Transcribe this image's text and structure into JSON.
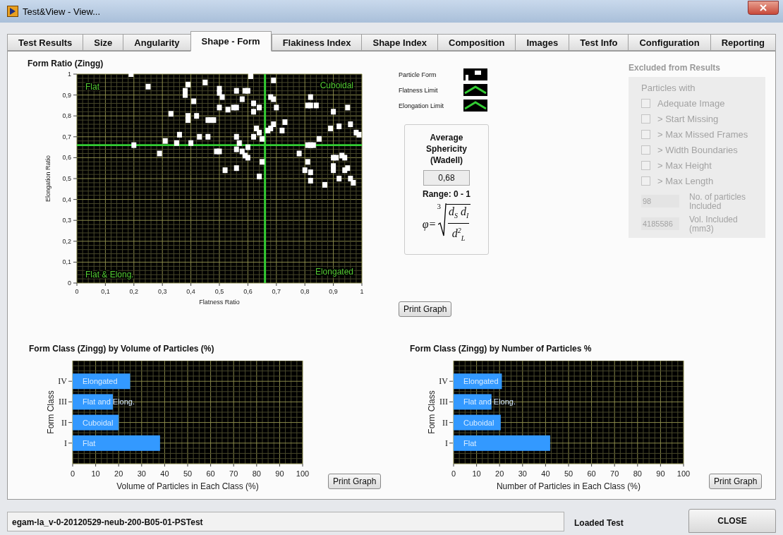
{
  "window": {
    "title": "Test&View - View..."
  },
  "tabs": [
    {
      "label": "Test Results",
      "selected": false
    },
    {
      "label": "Size",
      "selected": false
    },
    {
      "label": "Angularity",
      "selected": false
    },
    {
      "label": "Shape - Form",
      "selected": true
    },
    {
      "label": "Flakiness Index",
      "selected": false
    },
    {
      "label": "Shape Index",
      "selected": false
    },
    {
      "label": "Composition",
      "selected": false
    },
    {
      "label": "Images",
      "selected": false
    },
    {
      "label": "Test Info",
      "selected": false
    },
    {
      "label": "Configuration",
      "selected": false
    },
    {
      "label": "Reporting",
      "selected": false
    }
  ],
  "form_ratio": {
    "title": "Form Ratio (Zingg)",
    "print_button": "Print Graph",
    "chart_data": {
      "type": "scatter",
      "xlabel": "Flatness Ratio",
      "ylabel": "Elongation Ratio",
      "xlim": [
        0,
        1
      ],
      "ylim": [
        0,
        1
      ],
      "grid": true,
      "xticks": [
        {
          "value": 0,
          "label": "0"
        },
        {
          "value": 0.1,
          "label": "0,1"
        },
        {
          "value": 0.2,
          "label": "0,2"
        },
        {
          "value": 0.3,
          "label": "0,3"
        },
        {
          "value": 0.4,
          "label": "0,4"
        },
        {
          "value": 0.5,
          "label": "0,5"
        },
        {
          "value": 0.6,
          "label": "0,6"
        },
        {
          "value": 0.7,
          "label": "0,7"
        },
        {
          "value": 0.8,
          "label": "0,8"
        },
        {
          "value": 0.9,
          "label": "0,9"
        },
        {
          "value": 1,
          "label": "1"
        }
      ],
      "yticks": [
        {
          "value": 0,
          "label": "0"
        },
        {
          "value": 0.1,
          "label": "0,1"
        },
        {
          "value": 0.2,
          "label": "0,2"
        },
        {
          "value": 0.3,
          "label": "0,3"
        },
        {
          "value": 0.4,
          "label": "0,4"
        },
        {
          "value": 0.5,
          "label": "0,5"
        },
        {
          "value": 0.6,
          "label": "0,6"
        },
        {
          "value": 0.7,
          "label": "0,7"
        },
        {
          "value": 0.8,
          "label": "0,8"
        },
        {
          "value": 0.9,
          "label": "0,9"
        },
        {
          "value": 1,
          "label": "1"
        }
      ],
      "series": [
        {
          "name": "Particle Form",
          "color": "#ffffff",
          "x": [
            0.19,
            0.25,
            0.2,
            0.29,
            0.31,
            0.33,
            0.35,
            0.36,
            0.38,
            0.38,
            0.39,
            0.39,
            0.39,
            0.4,
            0.41,
            0.42,
            0.43,
            0.45,
            0.46,
            0.46,
            0.47,
            0.48,
            0.49,
            0.5,
            0.5,
            0.5,
            0.51,
            0.5,
            0.52,
            0.53,
            0.55,
            0.56,
            0.56,
            0.56,
            0.56,
            0.56,
            0.57,
            0.58,
            0.58,
            0.59,
            0.6,
            0.59,
            0.6,
            0.6,
            0.61,
            0.62,
            0.62,
            0.62,
            0.63,
            0.64,
            0.64,
            0.64,
            0.65,
            0.65,
            0.67,
            0.68,
            0.68,
            0.69,
            0.69,
            0.69,
            0.7,
            0.72,
            0.73,
            0.78,
            0.8,
            0.81,
            0.81,
            0.81,
            0.82,
            0.82,
            0.82,
            0.82,
            0.82,
            0.83,
            0.84,
            0.85,
            0.87,
            0.89,
            0.9,
            0.9,
            0.9,
            0.9,
            0.91,
            0.92,
            0.92,
            0.93,
            0.94,
            0.94,
            0.95,
            0.95,
            0.96,
            0.96,
            0.97,
            0.98,
            0.99
          ],
          "values": [
            1.0,
            0.94,
            0.66,
            0.62,
            0.68,
            0.81,
            0.67,
            0.71,
            0.92,
            0.9,
            0.95,
            0.8,
            0.78,
            0.67,
            0.87,
            0.8,
            0.7,
            0.96,
            0.7,
            0.78,
            0.78,
            0.78,
            0.63,
            0.63,
            0.93,
            0.91,
            0.89,
            0.84,
            0.54,
            0.83,
            0.84,
            0.84,
            0.92,
            0.7,
            0.64,
            0.55,
            0.67,
            0.88,
            0.63,
            0.92,
            0.92,
            0.61,
            0.6,
            0.65,
            0.99,
            0.86,
            0.82,
            0.7,
            0.74,
            0.84,
            0.72,
            0.51,
            0.69,
            0.58,
            0.73,
            0.74,
            0.89,
            0.97,
            0.88,
            0.76,
            0.84,
            0.73,
            0.77,
            0.62,
            0.54,
            0.85,
            0.66,
            0.58,
            0.89,
            0.85,
            0.66,
            0.53,
            0.49,
            0.66,
            0.85,
            0.69,
            0.47,
            0.74,
            0.82,
            0.6,
            0.56,
            0.54,
            0.6,
            0.75,
            0.5,
            0.61,
            0.6,
            0.54,
            0.84,
            0.55,
            0.76,
            0.5,
            0.48,
            0.72,
            0.71
          ]
        }
      ],
      "ref_lines": [
        {
          "axis": "x",
          "value": 0.66,
          "label": "Flatness Limit",
          "color": "#33cc33"
        },
        {
          "axis": "y",
          "value": 0.66,
          "label": "Elongation Limit",
          "color": "#33cc33"
        }
      ],
      "annotations": [
        "Flat",
        "Cuboidal",
        "Flat & Elong.",
        "Elongated"
      ]
    }
  },
  "sphericity": {
    "title": "Average Sphericity (Wadell)",
    "value": "0,68",
    "range": "Range: 0 - 1",
    "formula": {
      "lhs": "φ=",
      "index": "3",
      "numerator": "d$_{S}$ d$_{I}$",
      "denominator": "d$^{2}$$_{L}$"
    }
  },
  "excluded": {
    "title": "Excluded from Results",
    "subtitle": "Particles with",
    "disabled": true,
    "options": [
      {
        "label": "Adequate Image",
        "checked": false
      },
      {
        "label": "> Start Missing",
        "checked": false
      },
      {
        "label": "> Max Missed Frames",
        "checked": false
      },
      {
        "label": "> Width Boundaries",
        "checked": false
      },
      {
        "label": "> Max Height",
        "checked": false
      },
      {
        "label": "> Max Length",
        "checked": false
      }
    ],
    "fields": [
      {
        "value": "98",
        "label": "No. of particles Included"
      },
      {
        "value": "4185586",
        "label": "Vol. Included (mm3)"
      }
    ]
  },
  "volume_chart": {
    "title": "Form Class (Zingg) by Volume of Particles (%)",
    "print_button": "Print Graph",
    "chart_data": {
      "type": "bar",
      "orientation": "horizontal",
      "grid": true,
      "xlabel": "Volume of Particles in Each Class (%)",
      "ylabel": "Form Class",
      "categories": [
        "IV",
        "III",
        "II",
        "I"
      ],
      "xlim": [
        0,
        100
      ],
      "xticks": [
        0,
        10,
        20,
        30,
        40,
        50,
        60,
        70,
        80,
        90,
        100
      ],
      "series": [
        {
          "color": "#3399ff",
          "values": [
            25,
            17.5,
            20,
            38
          ]
        }
      ],
      "value_labels": [
        "Elongated",
        "Flat and Elong.",
        "Cuboidal",
        "Flat"
      ]
    }
  },
  "number_chart": {
    "title": "Form Class (Zingg) by Number of Particles %",
    "print_button": "Print Graph",
    "chart_data": {
      "type": "bar",
      "orientation": "horizontal",
      "grid": true,
      "xlabel": "Number of Particles in Each Class (%)",
      "ylabel": "Form Class",
      "categories": [
        "IV",
        "III",
        "II",
        "I"
      ],
      "xlim": [
        0,
        100
      ],
      "xticks": [
        0,
        10,
        20,
        30,
        40,
        50,
        60,
        70,
        80,
        90,
        100
      ],
      "series": [
        {
          "color": "#3399ff",
          "values": [
            21,
            16.5,
            20.5,
            42
          ]
        }
      ],
      "value_labels": [
        "Elongated",
        "Flat and Elong.",
        "Cuboidal",
        "Flat"
      ]
    }
  },
  "status_bar": {
    "file": "egam-la_v-0-20120529-neub-200-B05-01-PSTest",
    "state": "Loaded Test",
    "close_button": "CLOSE"
  }
}
